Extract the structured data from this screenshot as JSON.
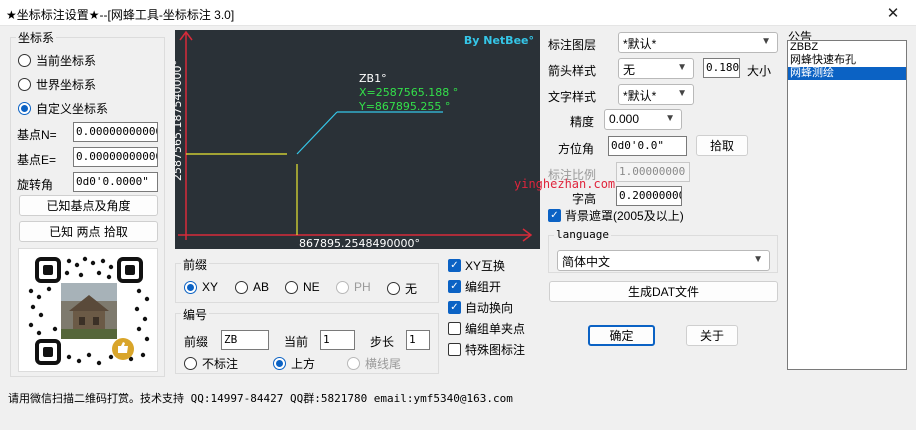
{
  "window": {
    "title": "★坐标标注设置★--[网蜂工具-坐标标注 3.0]",
    "close": "✕"
  },
  "coord_system": {
    "title": "坐标系",
    "options": [
      "当前坐标系",
      "世界坐标系",
      "自定义坐标系"
    ],
    "selected": "自定义坐标系",
    "base_n_label": "基点N=",
    "base_n_value": "0.000000000000",
    "base_e_label": "基点E=",
    "base_e_value": "0.000000000000",
    "rotation_label": "旋转角",
    "rotation_value": "0d0'0.0000\"",
    "btn_known_base": "已知基点及角度",
    "btn_two_points": "已知 两点 拾取"
  },
  "preview": {
    "brand": "By NetBee°",
    "point_name": "ZB1°",
    "x_text": "X=2587565.188 °",
    "y_text": "Y=867895.255 °",
    "y_axis_text": "2587565.187540000°",
    "x_axis_text": "867895.2548490000°"
  },
  "prefix": {
    "title": "前缀",
    "options": [
      "XY",
      "AB",
      "NE",
      "PH",
      "无"
    ],
    "selected": "XY",
    "disabled": [
      "PH"
    ]
  },
  "numbering": {
    "title": "编号",
    "prefix_label": "前缀",
    "prefix_value": "ZB",
    "current_label": "当前",
    "current_value": "1",
    "step_label": "步长",
    "step_value": "1",
    "options": [
      "不标注",
      "上方",
      "横线尾"
    ],
    "selected": "上方",
    "disabled": [
      "横线尾"
    ]
  },
  "checks": [
    {
      "label": "XY互换",
      "checked": true
    },
    {
      "label": "编组开",
      "checked": true
    },
    {
      "label": "自动换向",
      "checked": true
    },
    {
      "label": "编组单夹点",
      "checked": false
    },
    {
      "label": "特殊图标注",
      "checked": false
    }
  ],
  "settings": {
    "layer_label": "标注图层",
    "layer_value": "*默认*",
    "arrow_label": "箭头样式",
    "arrow_value": "无",
    "arrow_size_value": "0.1800",
    "arrow_size_label": "大小",
    "textstyle_label": "文字样式",
    "textstyle_value": "*默认*",
    "precision_label": "精度",
    "precision_value": "0.000",
    "azimuth_label": "方位角",
    "azimuth_value": "0d0'0.0\"",
    "pick_label": "拾取",
    "scale_label": "标注比例",
    "scale_value": "1.00000000",
    "height_label": "字高",
    "height_value": "0.20000000",
    "bgmask_label": "背景遮罩(2005及以上)",
    "bgmask_checked": true,
    "language_title": "language",
    "language_value": "简体中文",
    "dat_button": "生成DAT文件",
    "ok_button": "确定",
    "about_button": "关于"
  },
  "notice": {
    "title": "公告",
    "items": [
      "ZBBZ",
      "网蜂快速布孔",
      "网蜂测绘"
    ],
    "selected": "网蜂测绘"
  },
  "watermark": "yinghezhan.com",
  "status_text": "请用微信扫描二维码打赏。技术支持 QQ:14997-84427 QQ群:5821780 email:ymf5340@163.com",
  "colors": {
    "accent": "#0b62c4",
    "canvas_bg": "#2a3137",
    "cyan": "#35c6e8",
    "green": "#33e04a",
    "yellow": "#e9e833",
    "red": "#e0253c"
  }
}
